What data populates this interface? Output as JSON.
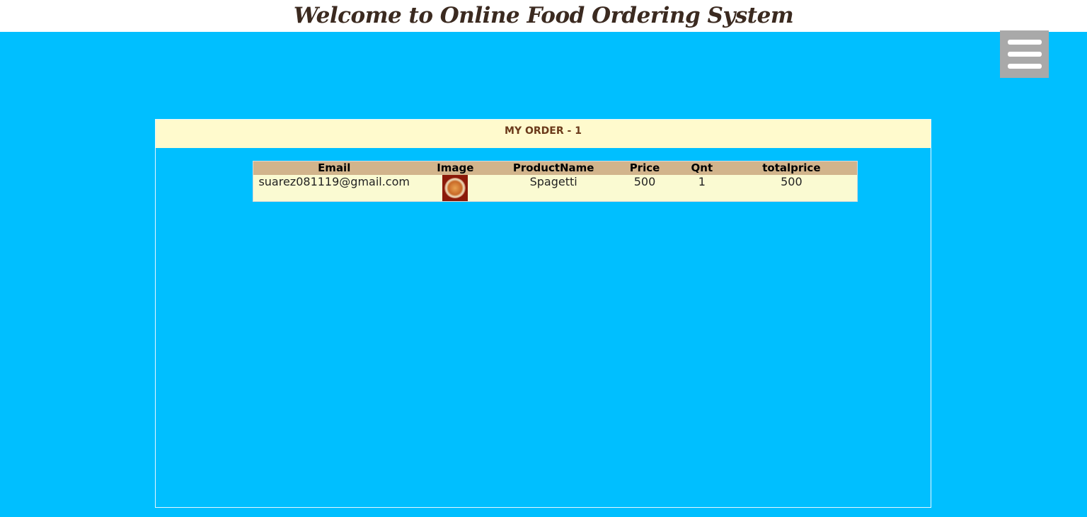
{
  "header": {
    "title": "Welcome to Online Food Ordering System"
  },
  "menu": {
    "icon": "hamburger-menu-icon"
  },
  "order_panel": {
    "title": "MY ORDER - 1",
    "columns": [
      "Email",
      "Image",
      "ProductName",
      "Price",
      "Qnt",
      "totalprice"
    ],
    "rows": [
      {
        "email": "suarez081119@gmail.com",
        "image": "spaghetti-thumbnail",
        "product_name": "Spagetti",
        "price": "500",
        "qnt": "1",
        "totalprice": "500"
      }
    ]
  },
  "colors": {
    "background": "#00bfff",
    "header_bar": "#ffffff",
    "panel_header": "#fffacd",
    "table_header": "#d2b48c",
    "table_row": "#fafad2",
    "menu_button": "#a9a9a9"
  }
}
